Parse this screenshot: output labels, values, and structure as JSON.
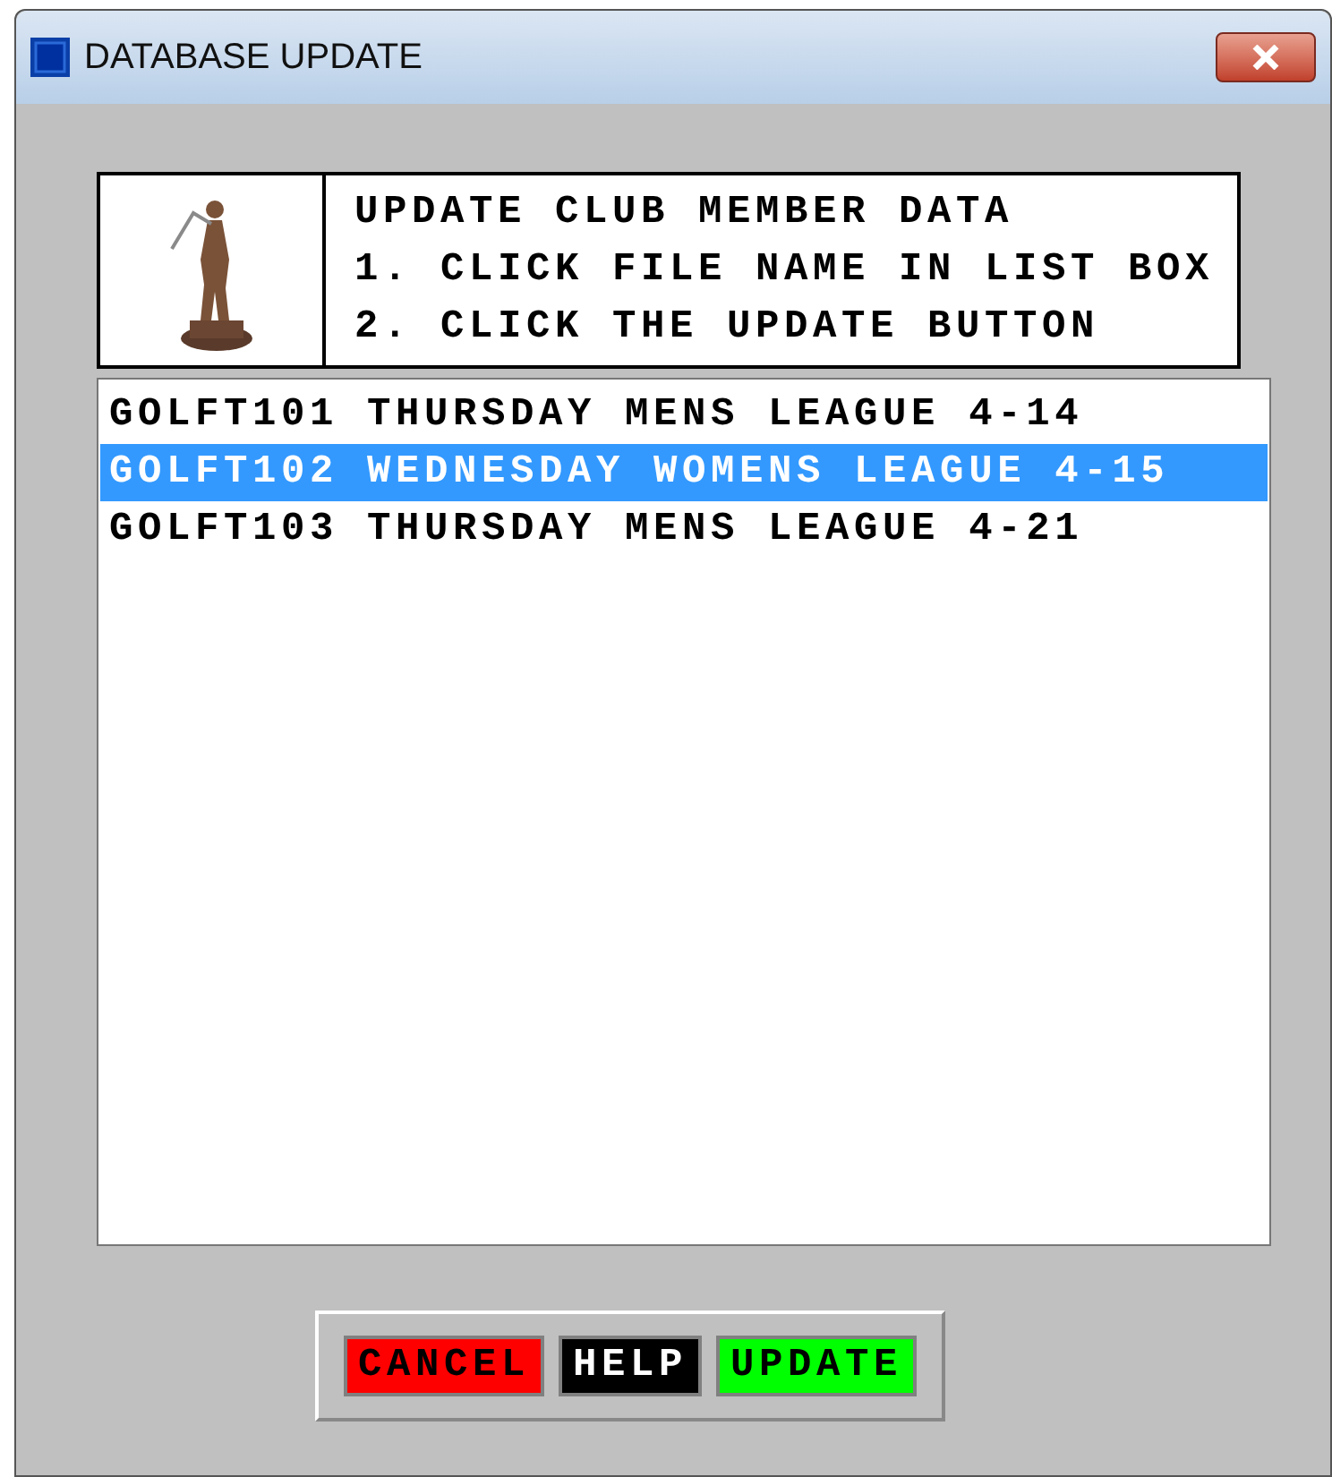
{
  "window": {
    "title": "DATABASE UPDATE"
  },
  "instructions": [
    "UPDATE CLUB MEMBER DATA",
    "1. CLICK FILE NAME IN LIST BOX",
    "2. CLICK THE UPDATE BUTTON"
  ],
  "files": [
    {
      "label": "GOLFT101 THURSDAY MENS LEAGUE 4-14",
      "selected": false
    },
    {
      "label": "GOLFT102 WEDNESDAY WOMENS LEAGUE 4-15",
      "selected": true
    },
    {
      "label": "GOLFT103 THURSDAY MENS LEAGUE 4-21",
      "selected": false
    }
  ],
  "buttons": [
    {
      "label": "CANCEL",
      "color": "#ff0000"
    },
    {
      "label": "HELP",
      "color": "#000000"
    },
    {
      "label": "UPDATE",
      "color": "#00ff00"
    }
  ]
}
